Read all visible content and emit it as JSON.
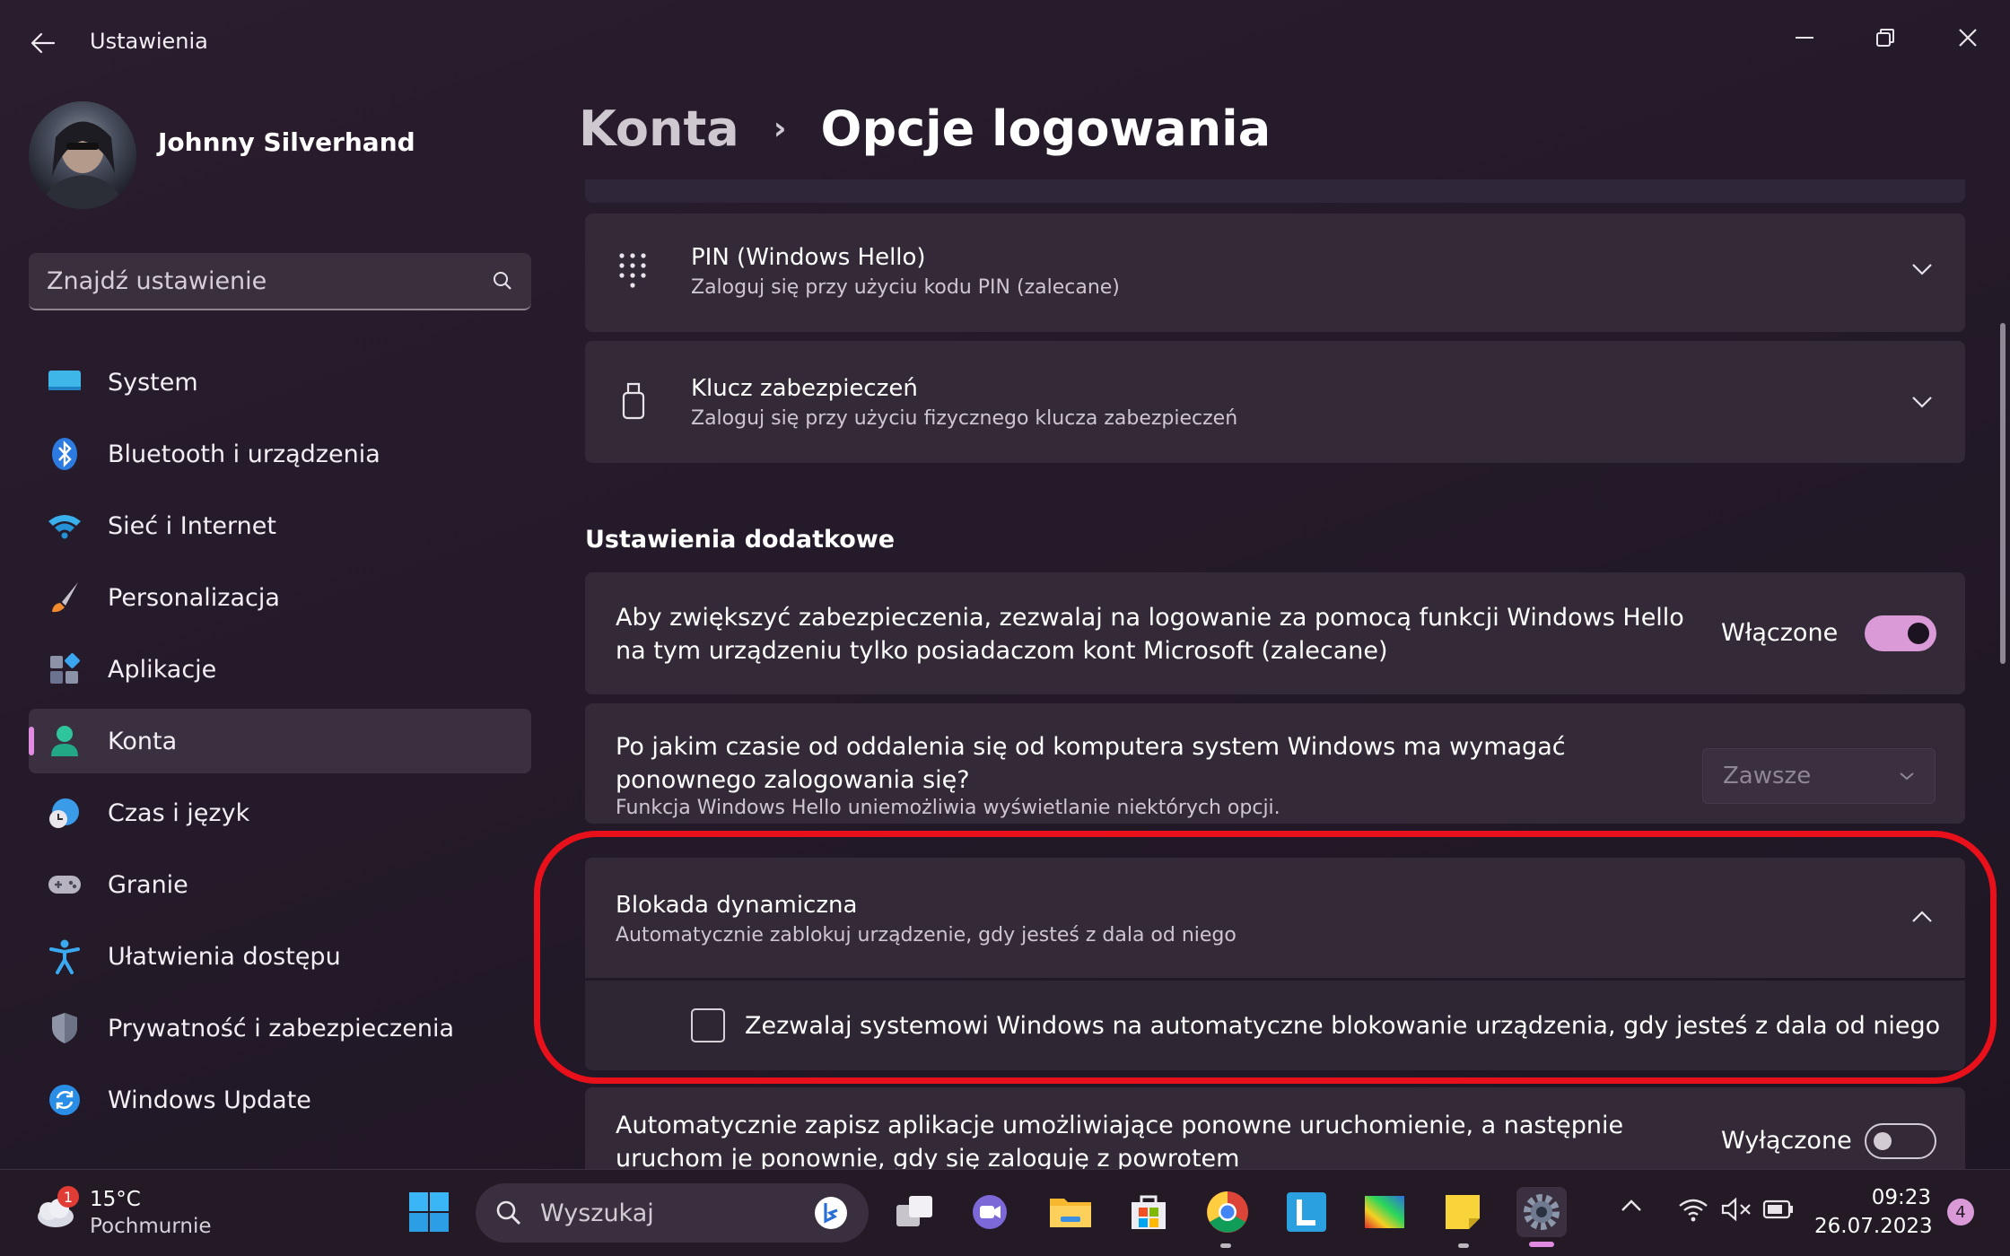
{
  "window": {
    "title": "Ustawienia"
  },
  "user": {
    "name": "Johnny Silverhand"
  },
  "search": {
    "placeholder": "Znajdź ustawienie"
  },
  "nav": [
    {
      "label": "System",
      "icon": "system-icon"
    },
    {
      "label": "Bluetooth i urządzenia",
      "icon": "bluetooth-icon"
    },
    {
      "label": "Sieć i Internet",
      "icon": "wifi-icon"
    },
    {
      "label": "Personalizacja",
      "icon": "brush-icon"
    },
    {
      "label": "Aplikacje",
      "icon": "apps-icon"
    },
    {
      "label": "Konta",
      "icon": "account-icon",
      "active": true
    },
    {
      "label": "Czas i język",
      "icon": "clock-globe-icon"
    },
    {
      "label": "Granie",
      "icon": "gamepad-icon"
    },
    {
      "label": "Ułatwienia dostępu",
      "icon": "accessibility-icon"
    },
    {
      "label": "Prywatność i zabezpieczenia",
      "icon": "shield-icon"
    },
    {
      "label": "Windows Update",
      "icon": "update-icon"
    }
  ],
  "breadcrumb": {
    "parent": "Konta",
    "separator": "›",
    "current": "Opcje logowania"
  },
  "signin_options": [
    {
      "title": "PIN (Windows Hello)",
      "subtitle": "Zaloguj się przy użyciu kodu PIN (zalecane)",
      "icon": "pin-keypad-icon"
    },
    {
      "title": "Klucz zabezpieczeń",
      "subtitle": "Zaloguj się przy użyciu fizycznego klucza zabezpieczeń",
      "icon": "usb-key-icon"
    }
  ],
  "additional": {
    "heading": "Ustawienia dodatkowe",
    "hello_only": {
      "text": "Aby zwiększyć zabezpieczenia, zezwalaj na logowanie za pomocą funkcji Windows Hello na tym urządzeniu tylko posiadaczom kont Microsoft (zalecane)",
      "state_label": "Włączone",
      "on": true
    },
    "require_signin": {
      "text": "Po jakim czasie od oddalenia się od komputera system Windows ma wymagać ponownego zalogowania się?",
      "note": "Funkcja Windows Hello uniemożliwia wyświetlanie niektórych opcji.",
      "dropdown_value": "Zawsze"
    },
    "dynamic_lock": {
      "title": "Blokada dynamiczna",
      "subtitle": "Automatycznie zablokuj urządzenie, gdy jesteś z dala od niego",
      "checkbox_label": "Zezwalaj systemowi Windows na automatyczne blokowanie urządzenia, gdy jesteś z dala od niego",
      "checked": false
    },
    "restart_apps": {
      "text": "Automatycznie zapisz aplikacje umożliwiające ponowne uruchomienie, a następnie uruchom je ponownie, gdy się zaloguję z powrotem",
      "state_label": "Wyłączone",
      "on": false
    }
  },
  "taskbar": {
    "weather": {
      "temp": "15°C",
      "desc": "Pochmurnie",
      "badge": "1"
    },
    "search_placeholder": "Wyszukaj",
    "time": "09:23",
    "date": "26.07.2023",
    "notifications": "4"
  },
  "colors": {
    "accent": "#d99ad7",
    "highlight_ring": "#e8101a",
    "background": "#241a29"
  }
}
